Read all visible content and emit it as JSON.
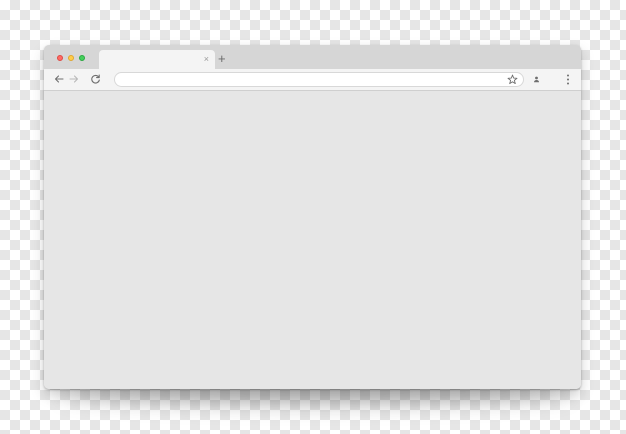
{
  "window": {
    "controls": [
      "close",
      "minimize",
      "maximize"
    ]
  },
  "tabs": [
    {
      "title": "",
      "close_label": "×"
    }
  ],
  "new_tab_label": "+",
  "toolbar": {
    "address_value": "",
    "address_placeholder": ""
  },
  "icons": {
    "back": "arrow-left",
    "forward": "arrow-right",
    "reload": "reload",
    "bookmark": "star",
    "profile": "user",
    "menu": "three-dots-vertical"
  },
  "colors": {
    "titlebar": "#d6d6d6",
    "toolbar": "#f4f4f4",
    "content": "#e6e6e6",
    "close": "#ff6a64",
    "minimize": "#ffcd4a",
    "maximize": "#44cf5c"
  }
}
